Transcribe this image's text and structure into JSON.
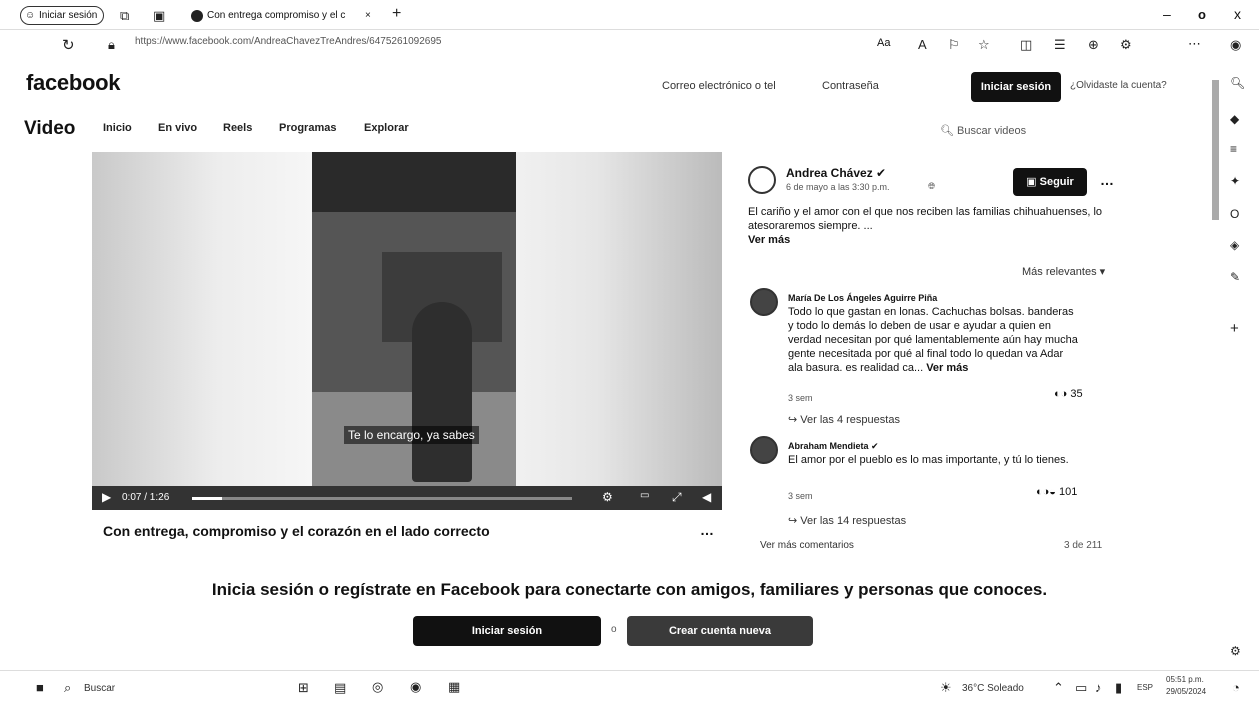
{
  "browser": {
    "tab_signin": "Iniciar sesión",
    "tab_title": "Con entrega compromiso y el c",
    "url": "https://www.facebook.com/AndreaChavezTreAndres/6475261092695",
    "window_controls": {
      "minimize": "–",
      "maximize": "o",
      "close": "x"
    }
  },
  "header": {
    "logo": "facebook",
    "email_label": "Correo electrónico o tel",
    "password_label": "Contraseña",
    "login_button": "Iniciar sesión",
    "forgot": "¿Olvidaste la cuenta?"
  },
  "video_nav": {
    "title": "Video",
    "items": [
      "Inicio",
      "En vivo",
      "Reels",
      "Programas",
      "Explorar"
    ],
    "search_placeholder": "Buscar videos"
  },
  "player": {
    "subtitle": "Te lo encargo, ya sabes",
    "time": "0:07 / 1:26",
    "progress": 0.08
  },
  "post": {
    "title": "Con entrega, compromiso y el corazón en el lado correcto",
    "more": "…"
  },
  "panel": {
    "author": "Andrea Chávez",
    "date": "6 de mayo a las 3:30 p.m.",
    "follow": "Seguir",
    "text": "El cariño y el amor con el que nos reciben las familias chihuahuenses, lo atesoraremos siempre. ...",
    "see_more": "Ver más",
    "relevant": "Más relevantes",
    "comments": [
      {
        "name": "María De Los Ángeles Aguirre Piña",
        "text": "Todo lo que gastan en lonas. Cachuchas bolsas. banderas y todo lo demás lo deben de usar e ayudar a quien en verdad necesitan por qué lamentablemente aún hay mucha gente necesitada por qué al final todo lo quedan va Adar ala basura. es realidad ca...",
        "text_more": "Ver más",
        "age": "3 sem",
        "reactions": "35",
        "replies": "Ver las 4 respuestas"
      },
      {
        "name": "Abraham Mendieta",
        "text": "El amor por el pueblo es lo mas importante, y tú lo tienes.",
        "age": "3 sem",
        "reactions": "101",
        "replies": "Ver las 14 respuestas"
      }
    ],
    "more_comments": "Ver más comentarios",
    "count": "3 de 211"
  },
  "cta": {
    "text": "Inicia sesión o regístrate en Facebook para conectarte con amigos, familiares y personas que conoces.",
    "login": "Iniciar sesión",
    "or": "o",
    "create": "Crear cuenta nueva"
  },
  "taskbar": {
    "search": "Buscar",
    "weather": "36°C Soleado",
    "lang": "ESP",
    "time": "05:51 p.m.",
    "date": "29/05/2024"
  }
}
